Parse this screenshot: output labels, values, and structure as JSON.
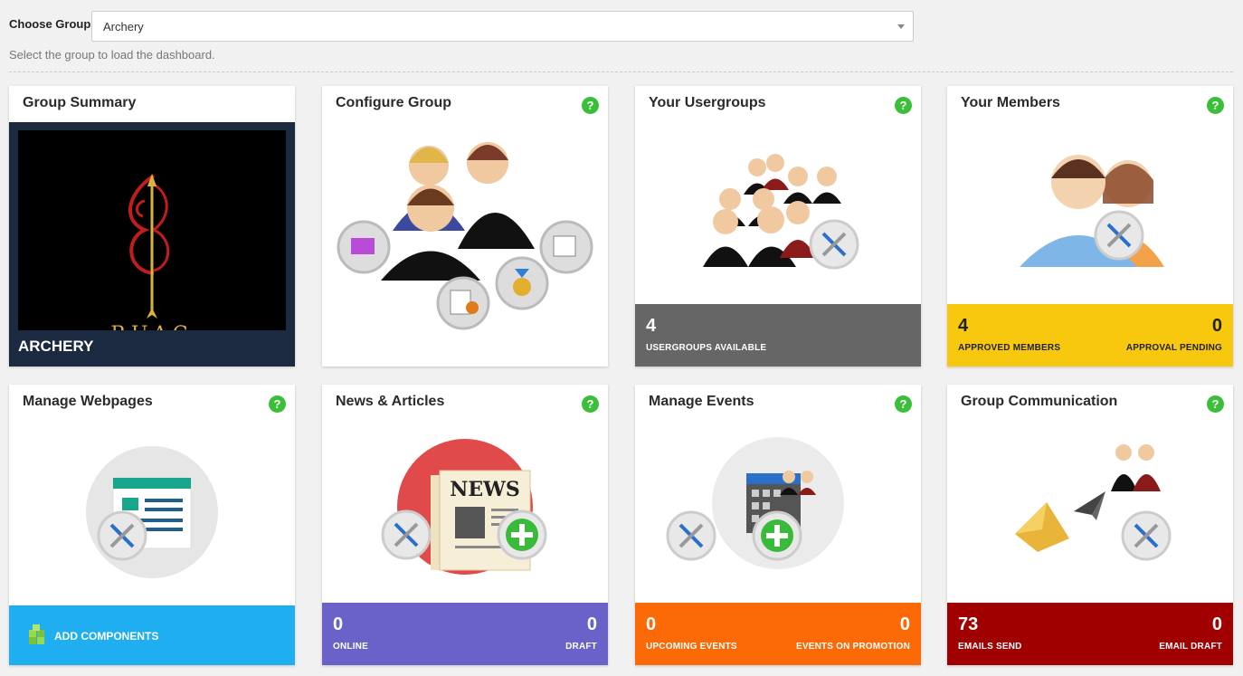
{
  "header": {
    "choose_label": "Choose Group",
    "selected_group": "Archery",
    "hint": "Select the group to load the dashboard."
  },
  "cards": {
    "summary": {
      "title": "Group Summary",
      "name": "ARCHERY",
      "logo_text": "RUAC"
    },
    "configure": {
      "title": "Configure Group"
    },
    "usergroups": {
      "title": "Your Usergroups",
      "count": "4",
      "count_label": "USERGROUPS AVAILABLE",
      "color": "#666666"
    },
    "members": {
      "title": "Your Members",
      "approved": "4",
      "approved_label": "APPROVED MEMBERS",
      "pending": "0",
      "pending_label": "APPROVAL PENDING",
      "color": "#f8c80f"
    },
    "webpages": {
      "title": "Manage Webpages",
      "action_label": "ADD COMPONENTS",
      "color": "#1faef0"
    },
    "news": {
      "title": "News & Articles",
      "online": "0",
      "online_label": "ONLINE",
      "draft": "0",
      "draft_label": "DRAFT",
      "color": "#6a62c8",
      "news_word": "NEWS"
    },
    "events": {
      "title": "Manage Events",
      "upcoming": "0",
      "upcoming_label": "UPCOMING EVENTS",
      "promotion": "0",
      "promotion_label": "EVENTS ON PROMOTION",
      "color": "#fb6a06"
    },
    "communication": {
      "title": "Group Communication",
      "sent": "73",
      "sent_label": "EMAILS SEND",
      "draft": "0",
      "draft_label": "EMAIL DRAFT",
      "color": "#a00000"
    }
  },
  "help_glyph": "?"
}
